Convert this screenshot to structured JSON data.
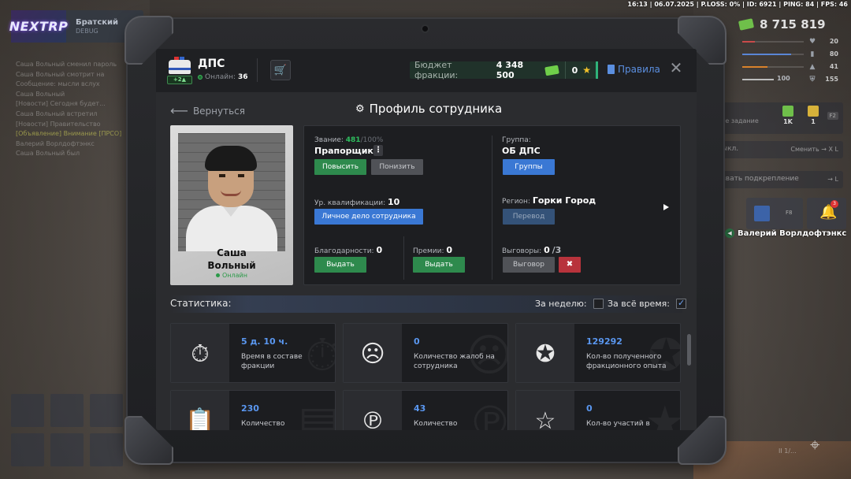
{
  "hud": {
    "debug_line": "16:13 | 06.07.2025 | P.LOSS: 0% | ID: 6921 | PING: 84 | FPS: 46",
    "logo_text": "NEXTRP",
    "server_name": "Братский",
    "server_sub": "DEBUG",
    "money": "8 715 819",
    "stat_rows": [
      {
        "icon": "blood-icon",
        "value": "20",
        "bar_color": "#c94a4a",
        "bar_pct": 0.2
      },
      {
        "icon": "food-icon",
        "value": "80",
        "bar_color": "#5a86d6",
        "bar_pct": 0.8
      },
      {
        "icon": "fuel-icon",
        "value": "41",
        "bar_color": "#d9822b",
        "bar_pct": 0.41
      },
      {
        "icon": "shield-icon",
        "value": "155",
        "left_value": "100",
        "bar_color": "#bdbdbd",
        "bar_pct": 1.0
      }
    ],
    "task_label": "се задание",
    "task_b1": "1K",
    "task_b2": "1",
    "task_key": "F2",
    "line1_left": "ыкл.",
    "line1_right": "Сменить → X L",
    "line2_left": "звать подкрепление",
    "line2_right": "→ L",
    "card1_key": "F8",
    "notif_count": "3",
    "speaker_name": "Валерий Ворлдофтэнкс",
    "pause": "II 1/...",
    "chat_lines": [
      "Саша Вольный сменил пароль",
      "Саша Вольный смотрит на",
      "Сообщение: мысли вслух",
      "Саша Вольный",
      "[Новости] Сегодня будет...",
      "Саша Вольный встретил",
      "[Новости] Правительство",
      "[Объявление] Внимание [ПРСО]",
      "Валерий Ворлдофтэнкс",
      "Саша Вольный был"
    ]
  },
  "header": {
    "faction_name": "ДПС",
    "rank_badge": "+2",
    "online_label": "Онлайн:",
    "online_count": "36",
    "budget_label": "Бюджет фракции:",
    "budget_amount": "4 348 500",
    "stars": "0",
    "rules": "Правила",
    "close": "✕"
  },
  "page": {
    "back": "Вернуться",
    "title": "Профиль сотрудника"
  },
  "profile": {
    "first_name": "Саша",
    "last_name": "Вольный",
    "status": "Онлайн"
  },
  "info": {
    "rank_label": "Звание:",
    "rank_pct": "481",
    "rank_pct_rest": "/100%",
    "rank_value": "Прапорщик",
    "promote": "Повысить",
    "demote": "Понизить",
    "group_label": "Группа:",
    "group_value": "ОБ ДПС",
    "groups_btn": "Группы",
    "qual_label": "Ур. квалификации:",
    "qual_value": "10",
    "dossier_btn": "Личное дело сотрудника",
    "region_label": "Регион:",
    "region_value": "Горки Город",
    "transfer_btn": "Перевод",
    "thanks_label": "Благодарности:",
    "thanks_value": "0",
    "thanks_btn": "Выдать",
    "bonus_label": "Премии:",
    "bonus_value": "0",
    "bonus_btn": "Выдать",
    "reprimand_label": "Выговоры:",
    "reprimand_value": "0",
    "reprimand_max": "/3",
    "reprimand_btn": "Выговор"
  },
  "stats": {
    "title": "Статистика:",
    "week": "За неделю:",
    "week_checked": false,
    "all_time": "За всё время:",
    "all_time_checked": true,
    "cards": [
      {
        "icon": "stopwatch-icon",
        "value": "5 д. 10 ч.",
        "label": "Время в составе фракции"
      },
      {
        "icon": "complaint-icon",
        "value": "0",
        "label": "Количество жалоб на сотрудника"
      },
      {
        "icon": "exp-stars-icon",
        "value": "129292",
        "label": "Кол-во полученного фракционного опыта"
      },
      {
        "icon": "clipboard-icon",
        "value": "230",
        "label": "Количество"
      },
      {
        "icon": "fine-document-icon",
        "value": "43",
        "label": "Количество"
      },
      {
        "icon": "star-icon",
        "value": "0",
        "label": "Кол-во участий в"
      }
    ]
  },
  "colors": {
    "accent_blue": "#5a97f0",
    "accent_green": "#2e8a4d",
    "accent_red": "#b8333c",
    "panel": "#1d1e21"
  }
}
